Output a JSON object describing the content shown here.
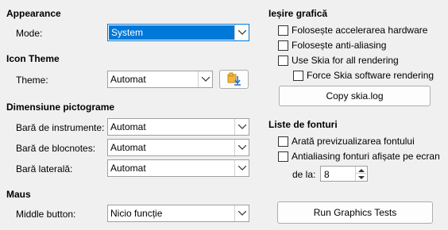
{
  "appearance": {
    "title": "Appearance",
    "mode_label": "Mode:",
    "mode_value": "System"
  },
  "icon_theme": {
    "title": "Icon Theme",
    "theme_label": "Theme:",
    "theme_value": "Automat"
  },
  "icon_size": {
    "title": "Dimensiune pictograme",
    "toolbar_label": "Bară de instrumente:",
    "toolbar_value": "Automat",
    "notebookbar_label": "Bară de blocnotes:",
    "notebookbar_value": "Automat",
    "sidebar_label": "Bară laterală:",
    "sidebar_value": "Automat"
  },
  "mouse": {
    "title": "Maus",
    "middle_label": "Middle button:",
    "middle_value": "Nicio funcție"
  },
  "graphics_output": {
    "title": "Ieșire grafică",
    "hw_accel": "Folosește accelerarea hardware",
    "anti_aliasing": "Folosește anti-aliasing",
    "skia_all": "Use Skia for all rendering",
    "skia_force_sw": "Force Skia software rendering",
    "copy_skia_button": "Copy skia.log"
  },
  "font_lists": {
    "title": "Liste de fonturi",
    "show_preview": "Arată previzualizarea fontului",
    "screen_aa": "Antialiasing fonturi afișate pe ecran",
    "from_label": "de la:",
    "from_value": "8"
  },
  "run_tests_button": "Run Graphics Tests",
  "colors": {
    "accent": "#0078d7",
    "background": "#f0f0f0"
  }
}
